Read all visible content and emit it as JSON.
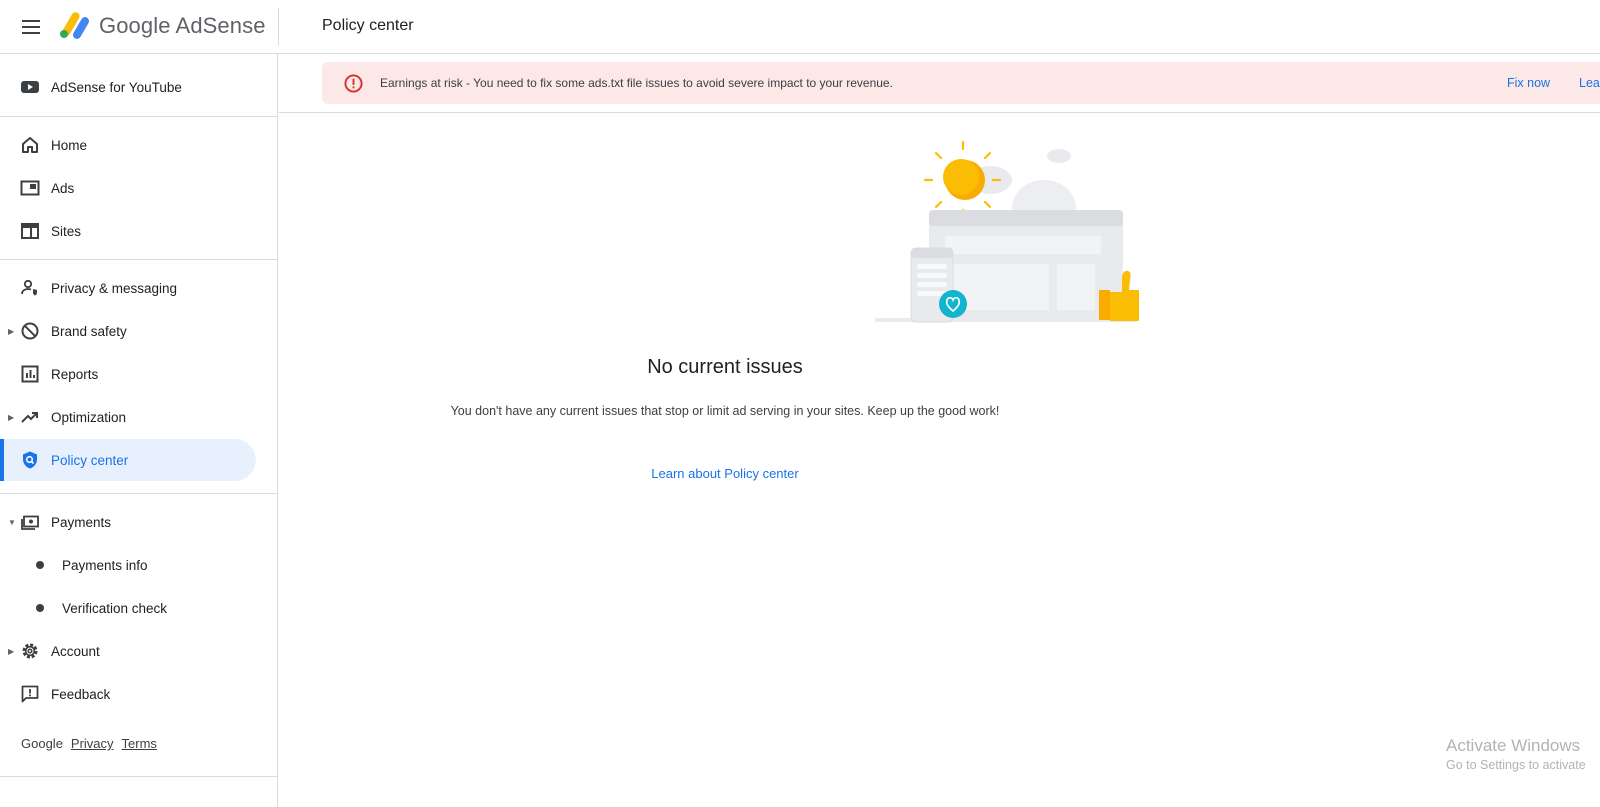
{
  "app": {
    "brand_name": "Google AdSense",
    "page_title": "Policy center"
  },
  "sidebar": {
    "youtube_label": "AdSense for YouTube",
    "items": [
      {
        "label": "Home"
      },
      {
        "label": "Ads"
      },
      {
        "label": "Sites"
      },
      {
        "label": "Privacy & messaging"
      },
      {
        "label": "Brand safety"
      },
      {
        "label": "Reports"
      },
      {
        "label": "Optimization"
      },
      {
        "label": "Policy center"
      },
      {
        "label": "Payments"
      },
      {
        "label": "Payments info"
      },
      {
        "label": "Verification check"
      },
      {
        "label": "Account"
      },
      {
        "label": "Feedback"
      }
    ],
    "active_item": "Policy center",
    "footer": {
      "google": "Google",
      "privacy": "Privacy",
      "terms": "Terms"
    }
  },
  "banner": {
    "message": "Earnings at risk - You need to fix some ads.txt file issues to avoid severe impact to your revenue.",
    "fix_label": "Fix now",
    "learn_label": "Lear",
    "color": "#fce8e6",
    "icon": "error-icon"
  },
  "main": {
    "title": "No current issues",
    "description": "You don't have any current issues that stop or limit ad serving in your sites. Keep up the good work!",
    "link_label": "Learn about Policy center"
  },
  "watermark": {
    "line1": "Activate Windows",
    "line2": "Go to Settings to activate"
  },
  "colors": {
    "accent": "#1a73e8",
    "active_bg": "#e8f0fe",
    "error": "#d93025"
  }
}
